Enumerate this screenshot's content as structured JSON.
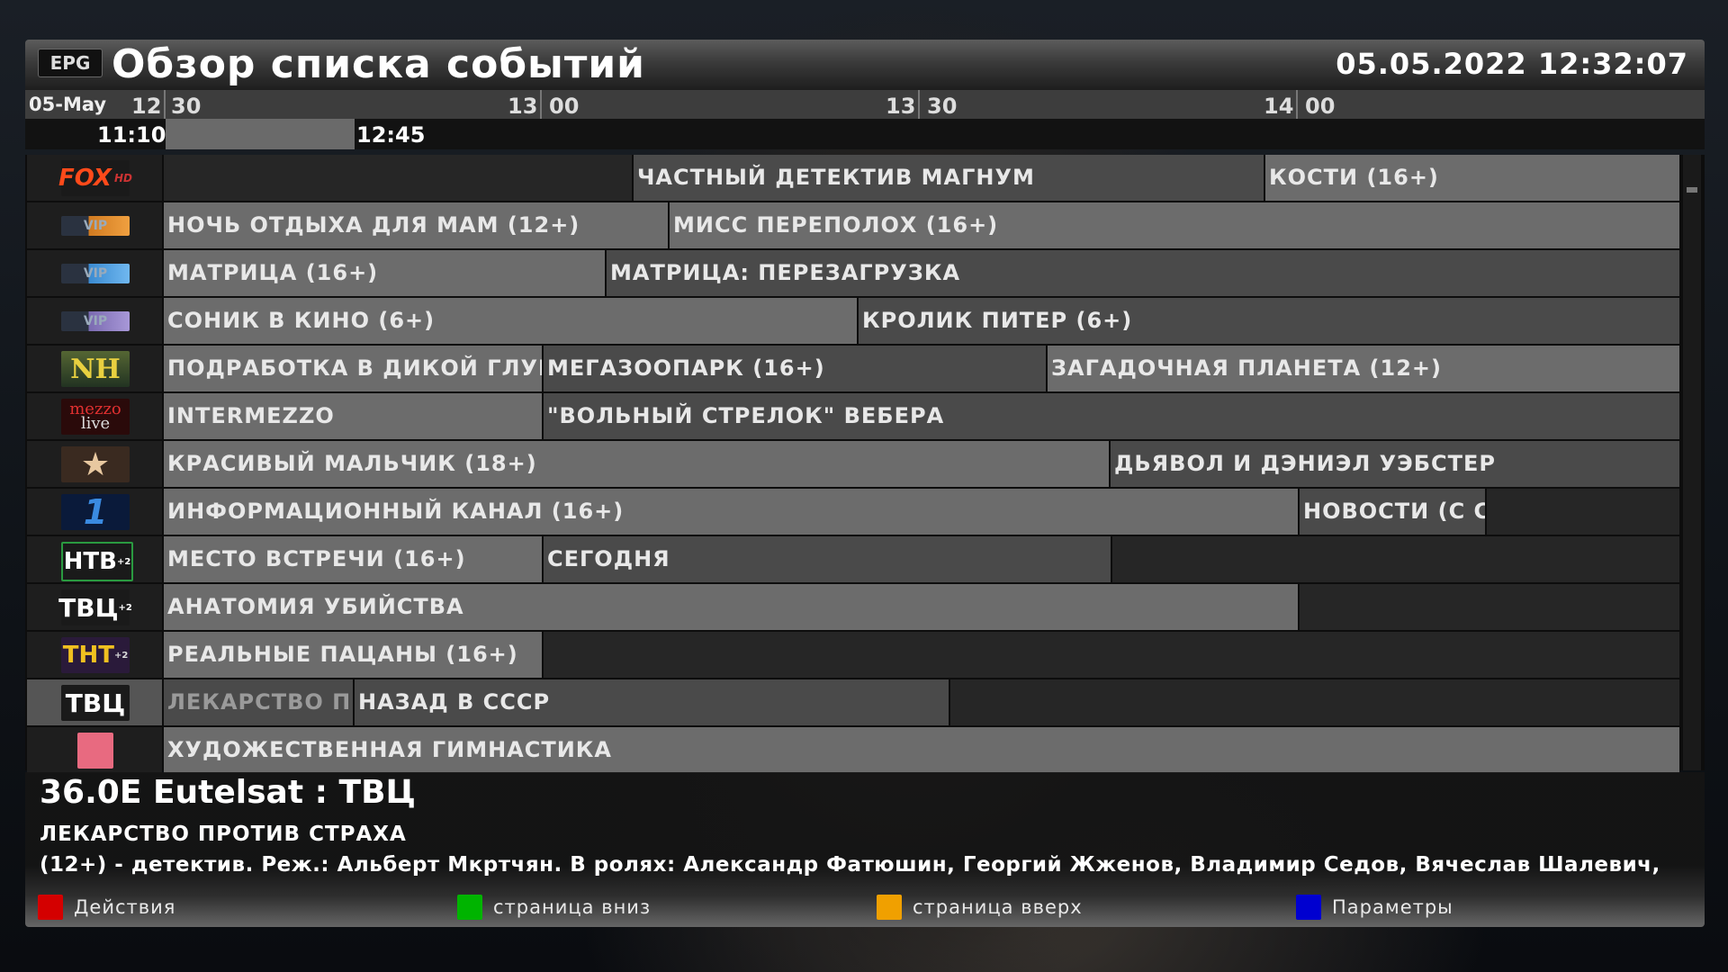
{
  "header": {
    "badge": "EPG",
    "title": "Обзор списка событий",
    "datetime": "05.05.2022 12:32:07"
  },
  "timeline": {
    "date": "05-May",
    "ticks": [
      {
        "h": "12",
        "m": "30"
      },
      {
        "h": "13",
        "m": "00"
      },
      {
        "h": "13",
        "m": "30"
      },
      {
        "h": "14",
        "m": "00"
      }
    ],
    "range_start": "11:10",
    "range_end": "12:45"
  },
  "channels": [
    {
      "logo_text": "FOX",
      "logo_sub": "HD",
      "icon": "fox-hd-logo",
      "events": [
        {
          "t": ""
        },
        {
          "t": "ЧАСТНЫЙ ДЕТЕКТИВ МАГНУМ"
        },
        {
          "t": "КОСТИ (16+)"
        }
      ]
    },
    {
      "logo_text": "VIP",
      "logo_sub": "",
      "icon": "vip-comedy-logo",
      "events": [
        {
          "t": "НОЧЬ ОТДЫХА ДЛЯ МАМ (12+)"
        },
        {
          "t": "МИСС ПЕРЕПОЛОХ (16+)"
        }
      ]
    },
    {
      "logo_text": "VIP",
      "logo_sub": "",
      "icon": "vip-megahit-logo",
      "events": [
        {
          "t": "МАТРИЦА (16+)"
        },
        {
          "t": "МАТРИЦА: ПЕРЕЗАГРУЗКА"
        }
      ]
    },
    {
      "logo_text": "VIP",
      "logo_sub": "",
      "icon": "vip-premiere-logo",
      "events": [
        {
          "t": "СОНИК В КИНО (6+)"
        },
        {
          "t": "КРОЛИК ПИТЕР (6+)"
        }
      ]
    },
    {
      "logo_text": "NH",
      "logo_sub": "",
      "icon": "nat-geo-wild-logo",
      "events": [
        {
          "t": "ПОДРАБОТКА В ДИКОЙ ГЛУШ"
        },
        {
          "t": "МЕГАЗООПАРК (16+)"
        },
        {
          "t": "ЗАГАДОЧНАЯ ПЛАНЕТА (12+)"
        }
      ]
    },
    {
      "logo_text": "mezzo",
      "logo_sub": "live",
      "icon": "mezzo-live-logo",
      "events": [
        {
          "t": "INTERMEZZO"
        },
        {
          "t": "\"ВОЛЬНЫЙ СТРЕЛОК\" ВЕБЕРА"
        }
      ]
    },
    {
      "logo_text": "★",
      "logo_sub": "",
      "icon": "hollywood-star-logo",
      "events": [
        {
          "t": "КРАСИВЫЙ МАЛЬЧИК (18+)"
        },
        {
          "t": "ДЬЯВОЛ И ДЭНИЭЛ УЭБСТЕР"
        }
      ]
    },
    {
      "logo_text": "1",
      "logo_sub": "",
      "icon": "first-channel-logo",
      "events": [
        {
          "t": "ИНФОРМАЦИОННЫЙ КАНАЛ (16+)"
        },
        {
          "t": "НОВОСТИ (С С"
        },
        {
          "t": ""
        }
      ]
    },
    {
      "logo_text": "НТВ",
      "logo_sub": "+2",
      "icon": "ntv-logo",
      "events": [
        {
          "t": "МЕСТО ВСТРЕЧИ (16+)"
        },
        {
          "t": "СЕГОДНЯ"
        },
        {
          "t": ""
        }
      ]
    },
    {
      "logo_text": "ТВЦ",
      "logo_sub": "+2",
      "icon": "tvc-logo",
      "events": [
        {
          "t": "АНАТОМИЯ УБИЙСТВА"
        },
        {
          "t": ""
        }
      ]
    },
    {
      "logo_text": "ТНТ",
      "logo_sub": "+2",
      "icon": "tnt-logo",
      "events": [
        {
          "t": "РЕАЛЬНЫЕ ПАЦАНЫ (16+)"
        },
        {
          "t": ""
        }
      ]
    },
    {
      "logo_text": "ТВЦ",
      "logo_sub": "",
      "icon": "tvc-logo",
      "events": [
        {
          "t": "ЛЕКАРСТВО П"
        },
        {
          "t": "НАЗАД В СССР"
        },
        {
          "t": ""
        }
      ]
    },
    {
      "logo_text": "",
      "logo_sub": "",
      "icon": "pink-channel-logo",
      "events": [
        {
          "t": "ХУДОЖЕСТВЕННАЯ ГИМНАСТИКА"
        }
      ]
    }
  ],
  "info": {
    "service": "36.0E Eutelsat : ТВЦ",
    "event_title": "ЛЕКАРСТВО ПРОТИВ СТРАХА",
    "description": "(12+)  - детектив.  Реж.: Альберт Мкртчян.  В ролях: Александр Фатюшин, Георгий Жженов, Владимир Седов, Вячеслав Шалевич,"
  },
  "buttons": [
    {
      "label": "Действия",
      "color": "#d40000"
    },
    {
      "label": "страница вниз",
      "color": "#00b400"
    },
    {
      "label": "страница вверх",
      "color": "#f0a000"
    },
    {
      "label": "Параметры",
      "color": "#0000d0"
    }
  ]
}
